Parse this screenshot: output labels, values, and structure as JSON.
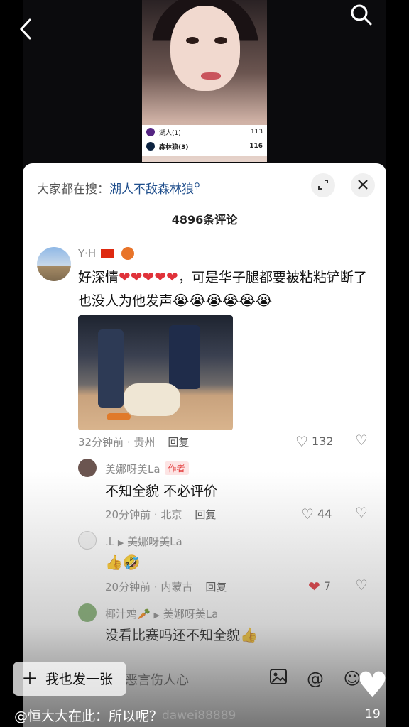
{
  "video": {
    "scoreboard": [
      {
        "team": "湖人(1)",
        "score": "113",
        "color": "#552583"
      },
      {
        "team": "森林狼(3)",
        "score": "116",
        "color": "#0c2340"
      }
    ]
  },
  "icons": {
    "back": "back-icon",
    "search": "search-icon"
  },
  "sheet": {
    "search_prefix": "大家都在搜：",
    "search_hot": "湖人不敌森林狼",
    "comment_count": "4896条评论"
  },
  "comments": [
    {
      "user": "Y·H",
      "text": "好深情",
      "text2": "，可是华子腿都要被粘粘铲断了也没人为他发声",
      "time_loc": "32分钟前 · 贵州",
      "reply": "回复",
      "likes": "132"
    }
  ],
  "replies": [
    {
      "user": "美娜呀美La",
      "tag": "作者",
      "text": "不知全貌 不必评价",
      "time_loc": "20分钟前 · 北京",
      "reply": "回复",
      "likes": "44"
    },
    {
      "user": ".L",
      "to": "美娜呀美La",
      "text": "",
      "time_loc": "20分钟前 · 内蒙古",
      "reply": "回复",
      "likes": "7"
    },
    {
      "user": "椰汁鸡",
      "to": "美娜呀美La",
      "text": "没看比赛吗还不知全貌"
    }
  ],
  "bottom": {
    "post_label": "我也发一张",
    "input_placeholder": "恶言伤人心",
    "caption": "@恒大大在此：所以呢？",
    "like_count": "19",
    "watermark": "dawei88889"
  }
}
